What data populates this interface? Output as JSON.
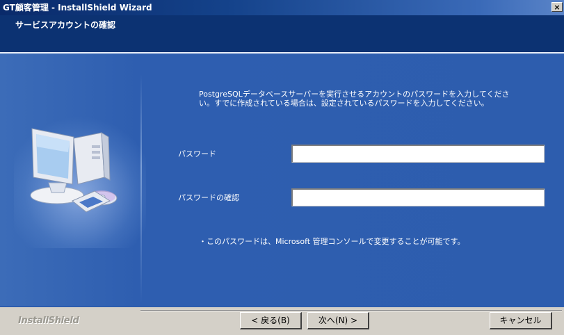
{
  "window": {
    "title": "GT顧客管理 - InstallShield Wizard",
    "close_label": "×"
  },
  "header": {
    "title": "サービスアカウントの確認"
  },
  "main": {
    "description": "PostgreSQLデータベースサーバーを実行させるアカウントのパスワードを入力してください。すでに作成されている場合は、設定されているパスワードを入力してください。",
    "password_label": "パスワード",
    "password_value": "",
    "confirm_label": "パスワードの確認",
    "confirm_value": "",
    "note": "・このパスワードは、Microsoft 管理コンソールで変更することが可能です。"
  },
  "footer": {
    "brand": "InstallShield",
    "back_label": "< 戻る(B)",
    "next_label": "次へ(N) >",
    "cancel_label": "キャンセル"
  },
  "colors": {
    "accent": "#2d5dae",
    "header": "#0c3272"
  },
  "icons": {
    "wizard_graphic": "computer-with-cd-icon"
  }
}
